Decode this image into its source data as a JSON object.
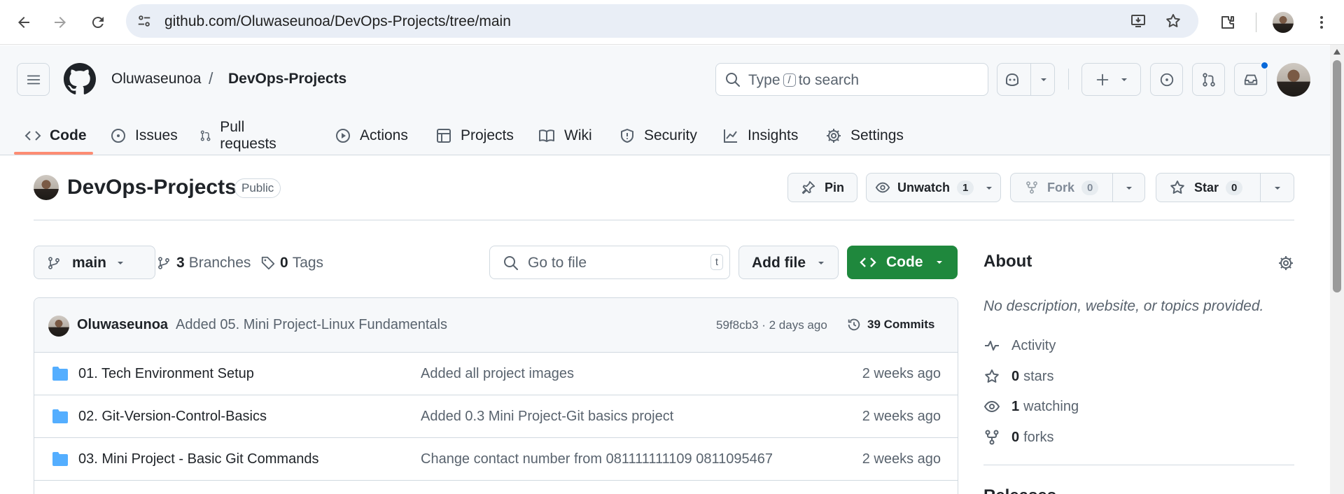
{
  "browser": {
    "url": "github.com/Oluwaseunoa/DevOps-Projects/tree/main",
    "icons": [
      "back-icon",
      "forward-icon",
      "reload-icon",
      "site-info-icon",
      "install-icon",
      "bookmark-star-icon",
      "extensions-icon",
      "profile-avatar",
      "kebab-menu-icon"
    ]
  },
  "header": {
    "owner": "Oluwaseunoa",
    "separator": "/",
    "repo": "DevOps-Projects",
    "search_prefix": "Type",
    "search_key": "/",
    "search_suffix": "to search"
  },
  "tabs": [
    {
      "label": "Code",
      "icon": "code-icon",
      "active": true
    },
    {
      "label": "Issues",
      "icon": "issue-icon"
    },
    {
      "label": "Pull requests",
      "icon": "pull-request-icon"
    },
    {
      "label": "Actions",
      "icon": "play-icon"
    },
    {
      "label": "Projects",
      "icon": "table-icon"
    },
    {
      "label": "Wiki",
      "icon": "book-icon"
    },
    {
      "label": "Security",
      "icon": "shield-icon"
    },
    {
      "label": "Insights",
      "icon": "graph-icon"
    },
    {
      "label": "Settings",
      "icon": "gear-icon"
    }
  ],
  "repo": {
    "title": "DevOps-Projects",
    "visibility": "Public",
    "pin_label": "Pin",
    "unwatch_label": "Unwatch",
    "watch_count": "1",
    "fork_label": "Fork",
    "fork_count": "0",
    "star_label": "Star",
    "star_count": "0"
  },
  "toolbar": {
    "branch": "main",
    "branches_count": "3",
    "branches_label": "Branches",
    "tags_count": "0",
    "tags_label": "Tags",
    "goto_placeholder": "Go to file",
    "goto_key": "t",
    "add_file_label": "Add file",
    "code_label": "Code"
  },
  "latest_commit": {
    "author": "Oluwaseunoa",
    "message": "Added 05. Mini Project-Linux Fundamentals",
    "hash_time": "59f8cb3 · 2 days ago",
    "commits_label": "39 Commits"
  },
  "files": [
    {
      "name": "01. Tech Environment Setup",
      "message": "Added all project images",
      "date": "2 weeks ago"
    },
    {
      "name": "02. Git-Version-Control-Basics",
      "message": "Added 0.3 Mini Project-Git basics project",
      "date": "2 weeks ago"
    },
    {
      "name": "03. Mini Project - Basic Git Commands",
      "message": "Change contact number from 081111111109 0811095467",
      "date": "2 weeks ago"
    }
  ],
  "about": {
    "title": "About",
    "description": "No description, website, or topics provided.",
    "activity_label": "Activity",
    "stars_count": "0",
    "stars_label": "stars",
    "watching_count": "1",
    "watching_label": "watching",
    "forks_count": "0",
    "forks_label": "forks",
    "releases_label": "Releases"
  },
  "colors": {
    "accent_green": "#1f883d",
    "tab_underline": "#fd8c73",
    "folder_blue": "#54aeff",
    "notification_dot": "#0969da"
  }
}
